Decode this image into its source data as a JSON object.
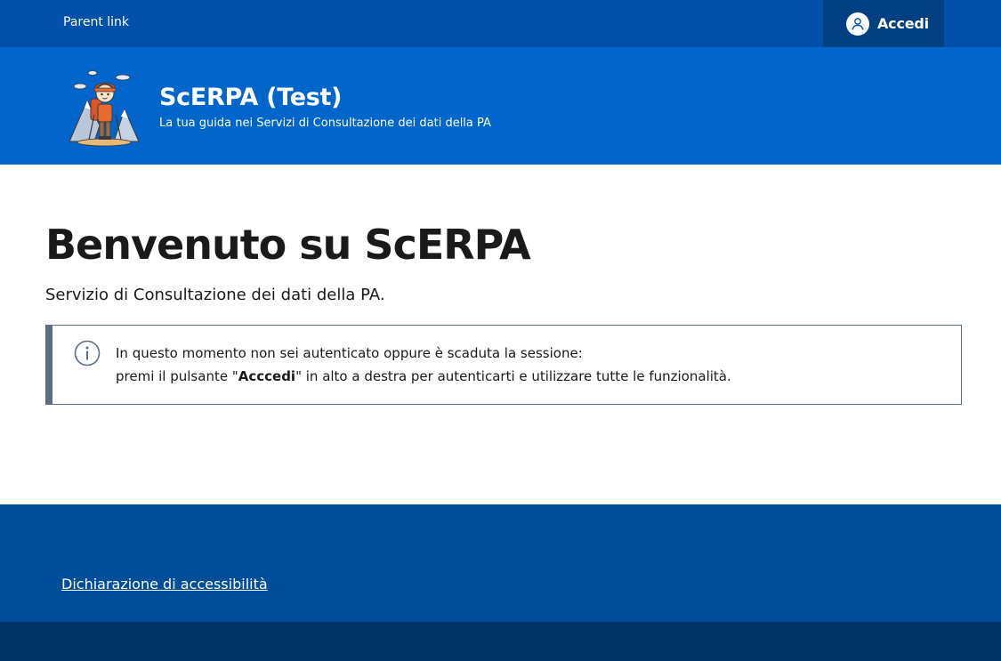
{
  "slim_header": {
    "parent_link": "Parent link",
    "login_label": "Accedi"
  },
  "brand": {
    "title": "ScERPA (Test)",
    "tagline": "La tua guida nei Servizi di Consultazione dei dati della PA"
  },
  "main": {
    "title": "Benvenuto su ScERPA",
    "lead": "Servizio di Consultazione dei dati della PA.",
    "alert": {
      "line1": "In questo momento non sei autenticato oppure è scaduta la sessione:",
      "line2_prefix": "premi il pulsante \"",
      "line2_bold": "Acccedi",
      "line2_suffix": "\" in alto a destra per autenticarti e utilizzare tutte le funzionalità."
    }
  },
  "footer": {
    "accessibility_link": "Dichiarazione di accessibilità"
  },
  "icons": {
    "login": "user-avatar-icon",
    "alert": "info-icon",
    "logo": "hiker-mascot-logo"
  },
  "colors": {
    "slim_header": "#0050a9",
    "login_button": "#003f82",
    "center_header": "#0066cc",
    "alert_border": "#5c6f82",
    "footer": "#004d99",
    "footer_bottom": "#003366"
  }
}
